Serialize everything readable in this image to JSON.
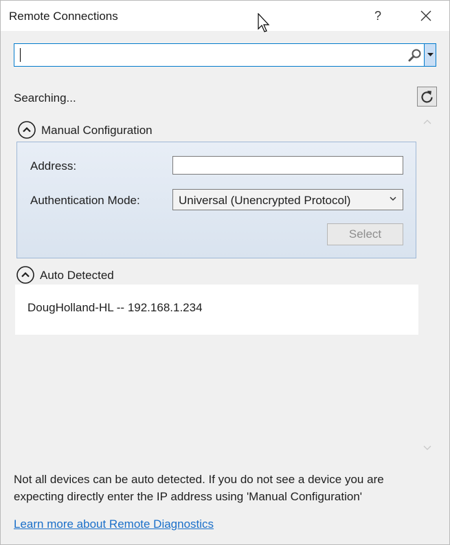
{
  "window": {
    "title": "Remote Connections",
    "help_label": "?"
  },
  "search": {
    "value": "",
    "placeholder": ""
  },
  "status": {
    "text": "Searching..."
  },
  "manual": {
    "header": "Manual Configuration",
    "address_label": "Address:",
    "address_value": "",
    "auth_label": "Authentication Mode:",
    "auth_value": "Universal (Unencrypted Protocol)",
    "select_label": "Select"
  },
  "auto": {
    "header": "Auto Detected",
    "devices": [
      {
        "label": "DougHolland-HL -- 192.168.1.234"
      }
    ]
  },
  "footer": {
    "note": "Not all devices can be auto detected. If you do not see a device you are expecting directly enter the IP address using 'Manual Configuration'",
    "link": "Learn more about Remote Diagnostics"
  },
  "colors": {
    "accent": "#007acc",
    "link": "#1a6fc9",
    "panel_border": "#9fb8d6"
  }
}
